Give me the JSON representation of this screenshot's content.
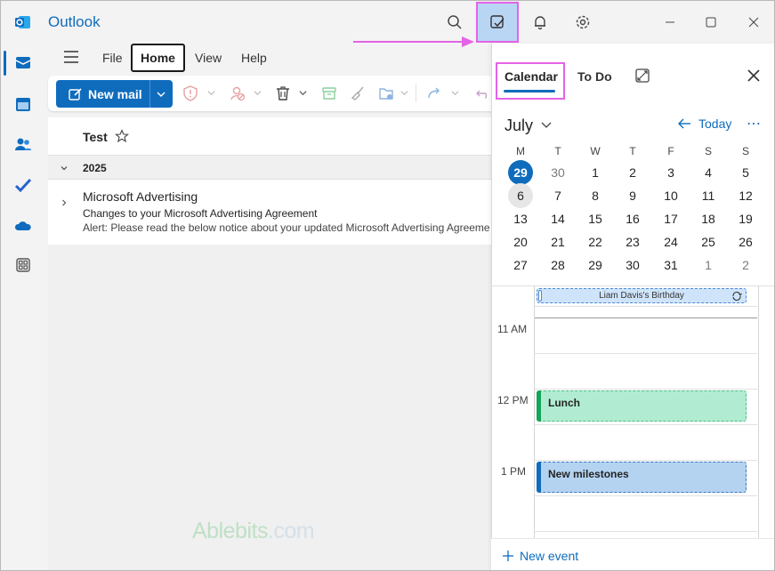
{
  "app": {
    "title": "Outlook"
  },
  "menu": {
    "file": "File",
    "home": "Home",
    "view": "View",
    "help": "Help"
  },
  "ribbon": {
    "new_mail": "New mail"
  },
  "folder": {
    "name": "Test"
  },
  "group": {
    "label": "2025"
  },
  "message": {
    "sender": "Microsoft Advertising",
    "subject": "Changes to your Microsoft Advertising Agreement",
    "preview": "Alert: Please read the below notice about your updated Microsoft Advertising Agreeme"
  },
  "watermark": {
    "brand": "Ablebits",
    "tld": ".com"
  },
  "panel": {
    "tab_calendar": "Calendar",
    "tab_todo": "To Do",
    "month": "July",
    "today": "Today",
    "weekdays": [
      "M",
      "T",
      "W",
      "T",
      "F",
      "S",
      "S"
    ],
    "weeks": [
      [
        "29",
        "30",
        "1",
        "2",
        "3",
        "4",
        "5"
      ],
      [
        "6",
        "7",
        "8",
        "9",
        "10",
        "11",
        "12"
      ],
      [
        "13",
        "14",
        "15",
        "16",
        "17",
        "18",
        "19"
      ],
      [
        "20",
        "21",
        "22",
        "23",
        "24",
        "25",
        "26"
      ],
      [
        "27",
        "28",
        "29",
        "30",
        "31",
        "1",
        "2"
      ]
    ],
    "today_date": "29",
    "selected_date": "6",
    "allday_event": "Liam Davis's Birthday",
    "times": [
      "11 AM",
      "12 PM",
      "1 PM"
    ],
    "events": [
      {
        "title": "Lunch",
        "color": "#13a657"
      },
      {
        "title": "New milestones",
        "color": "#0f6cbd"
      }
    ],
    "new_event": "New event"
  },
  "colors": {
    "accent": "#0f6cbd",
    "highlight": "#e463e6"
  }
}
